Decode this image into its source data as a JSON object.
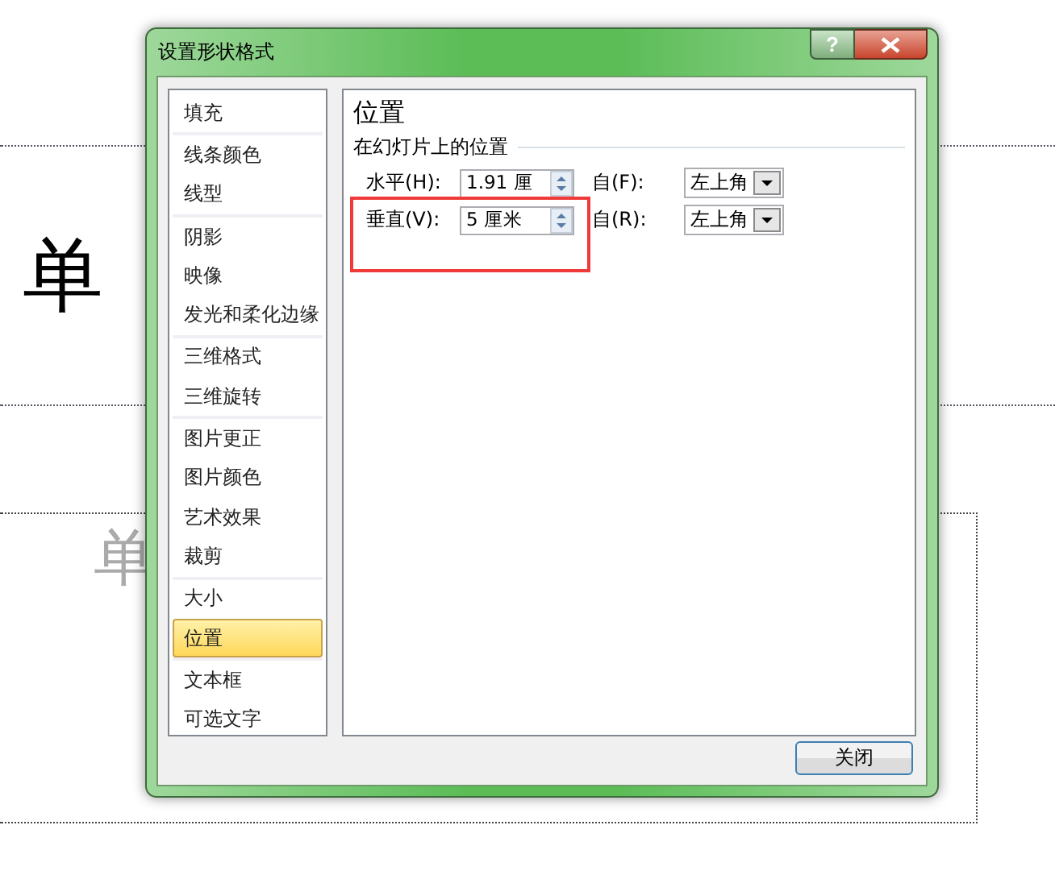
{
  "slide": {
    "title": "单",
    "subtitle": "单"
  },
  "window": {
    "title": "设置形状格式",
    "help": "?"
  },
  "sidebar": {
    "groups": [
      {
        "items": [
          {
            "label": "填充",
            "selected": false
          }
        ]
      },
      {
        "items": [
          {
            "label": "线条颜色",
            "selected": false
          },
          {
            "label": "线型",
            "selected": false
          }
        ]
      },
      {
        "items": [
          {
            "label": "阴影",
            "selected": false
          },
          {
            "label": "映像",
            "selected": false
          },
          {
            "label": "发光和柔化边缘",
            "selected": false
          }
        ]
      },
      {
        "items": [
          {
            "label": "三维格式",
            "selected": false
          },
          {
            "label": "三维旋转",
            "selected": false
          }
        ]
      },
      {
        "items": [
          {
            "label": "图片更正",
            "selected": false
          },
          {
            "label": "图片颜色",
            "selected": false
          },
          {
            "label": "艺术效果",
            "selected": false
          },
          {
            "label": "裁剪",
            "selected": false
          }
        ]
      },
      {
        "items": [
          {
            "label": "大小",
            "selected": false
          },
          {
            "label": "位置",
            "selected": true
          }
        ]
      },
      {
        "items": [
          {
            "label": "文本框",
            "selected": false
          },
          {
            "label": "可选文字",
            "selected": false
          }
        ]
      }
    ]
  },
  "panel": {
    "heading": "位置",
    "section": "在幻灯片上的位置",
    "rows": [
      {
        "label": "水平(H):",
        "value": "1.91 厘",
        "from_label": "自(F):",
        "from_value": "左上角",
        "highlighted": false
      },
      {
        "label": "垂直(V):",
        "value": "5 厘米",
        "from_label": "自(R):",
        "from_value": "左上角",
        "highlighted": true
      }
    ]
  },
  "buttons": [
    "关闭"
  ]
}
